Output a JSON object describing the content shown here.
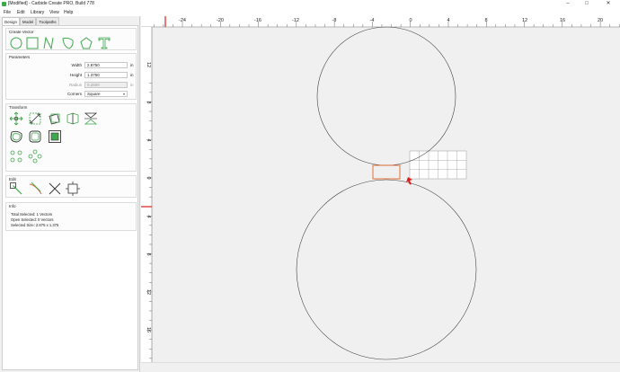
{
  "window": {
    "title": "[Modified] - Carbide Create PRO, Build 778",
    "controls": [
      "–",
      "□",
      "✕"
    ]
  },
  "menu": [
    "File",
    "Edit",
    "Library",
    "View",
    "Help"
  ],
  "tabs": [
    "Design",
    "Model",
    "Toolpaths"
  ],
  "create_vector": {
    "title": "Create Vector",
    "tools": [
      "circle-tool",
      "rectangle-tool",
      "curve-tool",
      "polygon-tool",
      "pentagon-tool",
      "text-tool"
    ]
  },
  "parameters": {
    "title": "Parameters",
    "width_label": "Width",
    "width_value": "2.8750",
    "height_label": "Height",
    "height_value": "1.3750",
    "radius_label": "Radius",
    "radius_value": "0.2500",
    "unit": "in",
    "corners_label": "Corners",
    "corners_value": "Square"
  },
  "transform": {
    "title": "Transform"
  },
  "edit": {
    "title": "Edit"
  },
  "info": {
    "title": "Info",
    "total_selected": "Total Selected:  1 Vectors",
    "open_selected": "Open Selected:  0 Vectors",
    "selected_size": "Selected Size:    2.875 x 1.375"
  },
  "ruler": {
    "x_ticks": [
      "-24",
      "-20",
      "-16",
      "-12",
      "-8",
      "-4",
      "0",
      "4",
      "8",
      "12",
      "16",
      "20"
    ],
    "y_ticks": [
      "12",
      "8",
      "4",
      "0",
      "4",
      "8",
      "12",
      "16"
    ]
  },
  "colors": {
    "accent_green": "#3fa84b",
    "selection_orange": "#e0622a",
    "origin_red": "#e01b1b",
    "ruler_marker": "#e01b1b"
  }
}
